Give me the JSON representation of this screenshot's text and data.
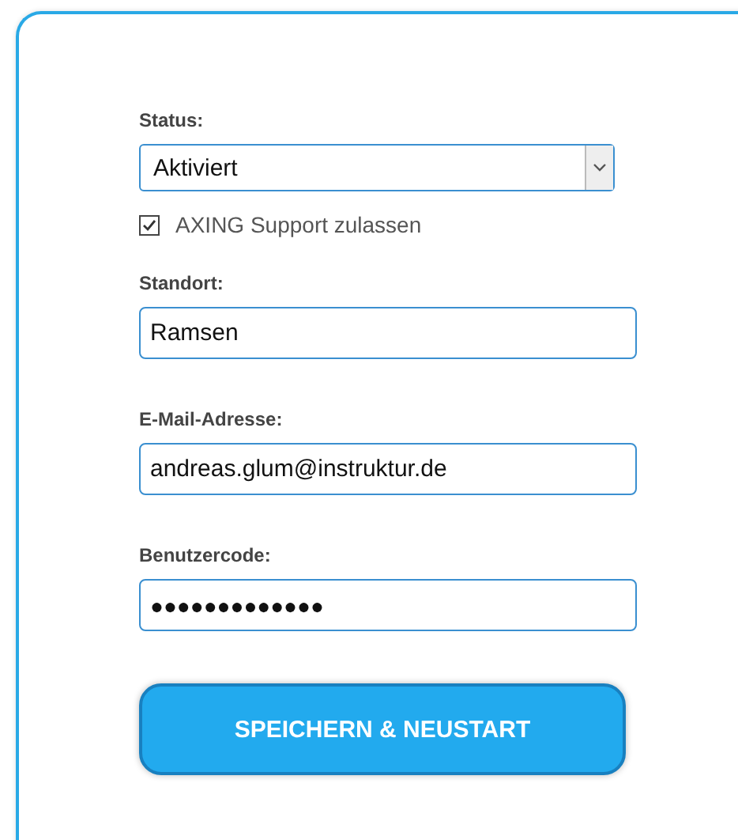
{
  "form": [
    {
      "kind": "select",
      "label": "Status:",
      "value": "Aktiviert"
    },
    {
      "kind": "checkbox",
      "label": "AXING Support zulassen",
      "checked": true
    },
    {
      "kind": "text",
      "label": "Standort:",
      "value": "Ramsen"
    },
    {
      "kind": "text",
      "label": "E-Mail-Adresse:",
      "value": "andreas.glum@instruktur.de"
    },
    {
      "kind": "password",
      "label": "Benutzercode:",
      "value": "●●●●●●●●●●●●●"
    }
  ],
  "button": "SPEICHERN & NEUSTART"
}
